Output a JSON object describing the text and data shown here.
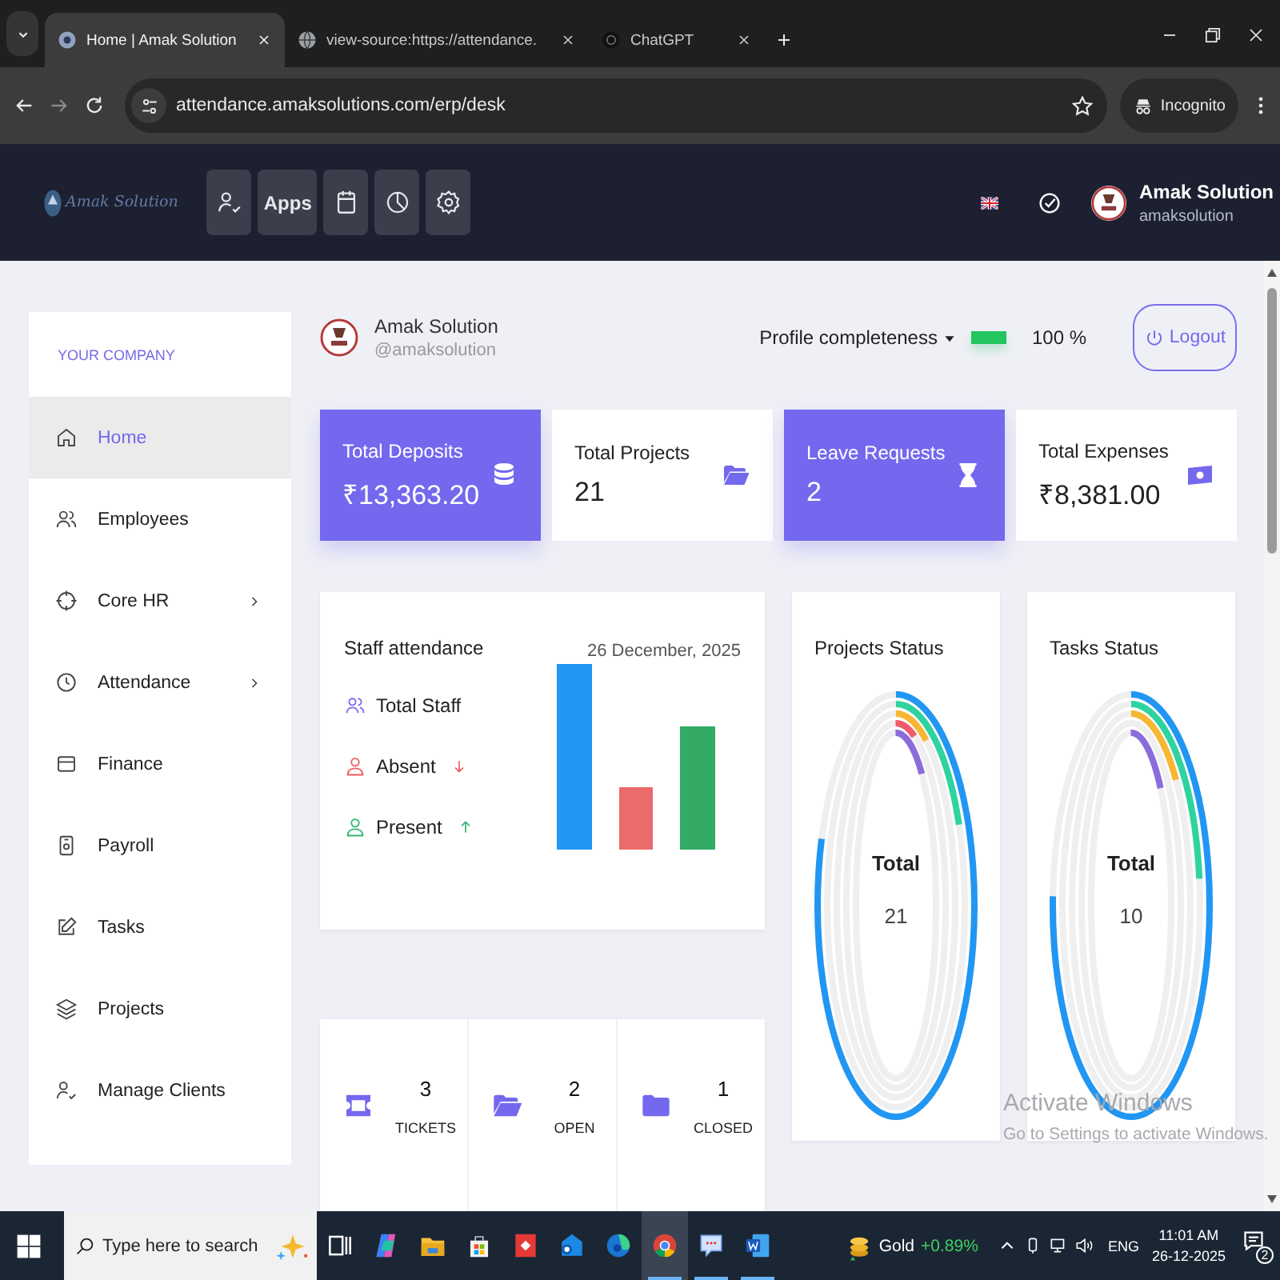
{
  "browser": {
    "tabs": [
      {
        "title": "Home | Amak Solution",
        "kind": "site",
        "selected": true
      },
      {
        "title": "view-source:https://attendance.",
        "kind": "globe",
        "selected": false
      },
      {
        "title": "ChatGPT",
        "kind": "chatgpt",
        "selected": false
      }
    ],
    "address": "attendance.amaksolutions.com/erp/desk",
    "profile_label": "Incognito"
  },
  "header": {
    "logo_text": "Amak Solution",
    "apps_label": "Apps",
    "user_name": "Amak Solution",
    "user_handle": "amaksolution"
  },
  "sidebar": {
    "heading": "YOUR COMPANY",
    "items": [
      {
        "label": "Home",
        "kind": "home",
        "selected": true,
        "submenu": false
      },
      {
        "label": "Employees",
        "kind": "users",
        "selected": false,
        "submenu": false
      },
      {
        "label": "Core HR",
        "kind": "target",
        "selected": false,
        "submenu": true
      },
      {
        "label": "Attendance",
        "kind": "clock",
        "selected": false,
        "submenu": true
      },
      {
        "label": "Finance",
        "kind": "card",
        "selected": false,
        "submenu": false
      },
      {
        "label": "Payroll",
        "kind": "payroll",
        "selected": false,
        "submenu": false
      },
      {
        "label": "Tasks",
        "kind": "edit",
        "selected": false,
        "submenu": false
      },
      {
        "label": "Projects",
        "kind": "layers",
        "selected": false,
        "submenu": false
      },
      {
        "label": "Manage Clients",
        "kind": "usercheck",
        "selected": false,
        "submenu": false
      }
    ]
  },
  "profile": {
    "name": "Amak Solution",
    "handle": "@amaksolution",
    "completeness_label": "Profile completeness",
    "level": 1,
    "percent": "100 %",
    "logout": "Logout"
  },
  "stats": [
    {
      "title": "Total Deposits",
      "value": "₹13,363.20",
      "kind": "database",
      "highlighted": true
    },
    {
      "title": "Total Projects",
      "value": "21",
      "kind": "folderopen",
      "highlighted": false
    },
    {
      "title": "Leave Requests",
      "value": "2",
      "kind": "hourglass",
      "highlighted": true
    },
    {
      "title": "Total Expenses",
      "value": "₹8,381.00",
      "kind": "money",
      "highlighted": false
    }
  ],
  "attendance": {
    "title": "Staff attendance",
    "date": "26 December, 2025",
    "legend": [
      {
        "label": "Total Staff",
        "kind": "total"
      },
      {
        "label": "Absent",
        "kind": "absent"
      },
      {
        "label": "Present",
        "kind": "present"
      }
    ]
  },
  "tickets": [
    {
      "count": "3",
      "label": "TICKETS",
      "kind": "ticket"
    },
    {
      "count": "2",
      "label": "OPEN",
      "kind": "folderopen"
    },
    {
      "count": "1",
      "label": "CLOSED",
      "kind": "folder"
    }
  ],
  "status_cards": [
    {
      "title": "Projects Status",
      "total_label": "Total",
      "total": "21"
    },
    {
      "title": "Tasks Status",
      "total_label": "Total",
      "total": "10"
    }
  ],
  "activation": {
    "title": "Activate Windows",
    "hint": "Go to Settings to activate Windows."
  },
  "taskbar": {
    "search_placeholder": "Type here to search",
    "apps": [
      {
        "kind": "taskview",
        "running": false,
        "selected": false
      },
      {
        "kind": "copilot",
        "running": false,
        "selected": false
      },
      {
        "kind": "explorer",
        "running": false,
        "selected": false
      },
      {
        "kind": "store",
        "running": false,
        "selected": false
      },
      {
        "kind": "remote",
        "running": false,
        "selected": false
      },
      {
        "kind": "outlook",
        "running": false,
        "selected": false
      },
      {
        "kind": "edge",
        "running": false,
        "selected": false
      },
      {
        "kind": "chrome",
        "running": true,
        "selected": true
      },
      {
        "kind": "chat",
        "running": true,
        "selected": false
      },
      {
        "kind": "word",
        "running": true,
        "selected": false
      }
    ],
    "ticker": {
      "name": "Gold",
      "change": "+0.89%"
    },
    "language": "ENG",
    "time": "11:01 AM",
    "date": "26-12-2025",
    "notifications": "2"
  }
}
